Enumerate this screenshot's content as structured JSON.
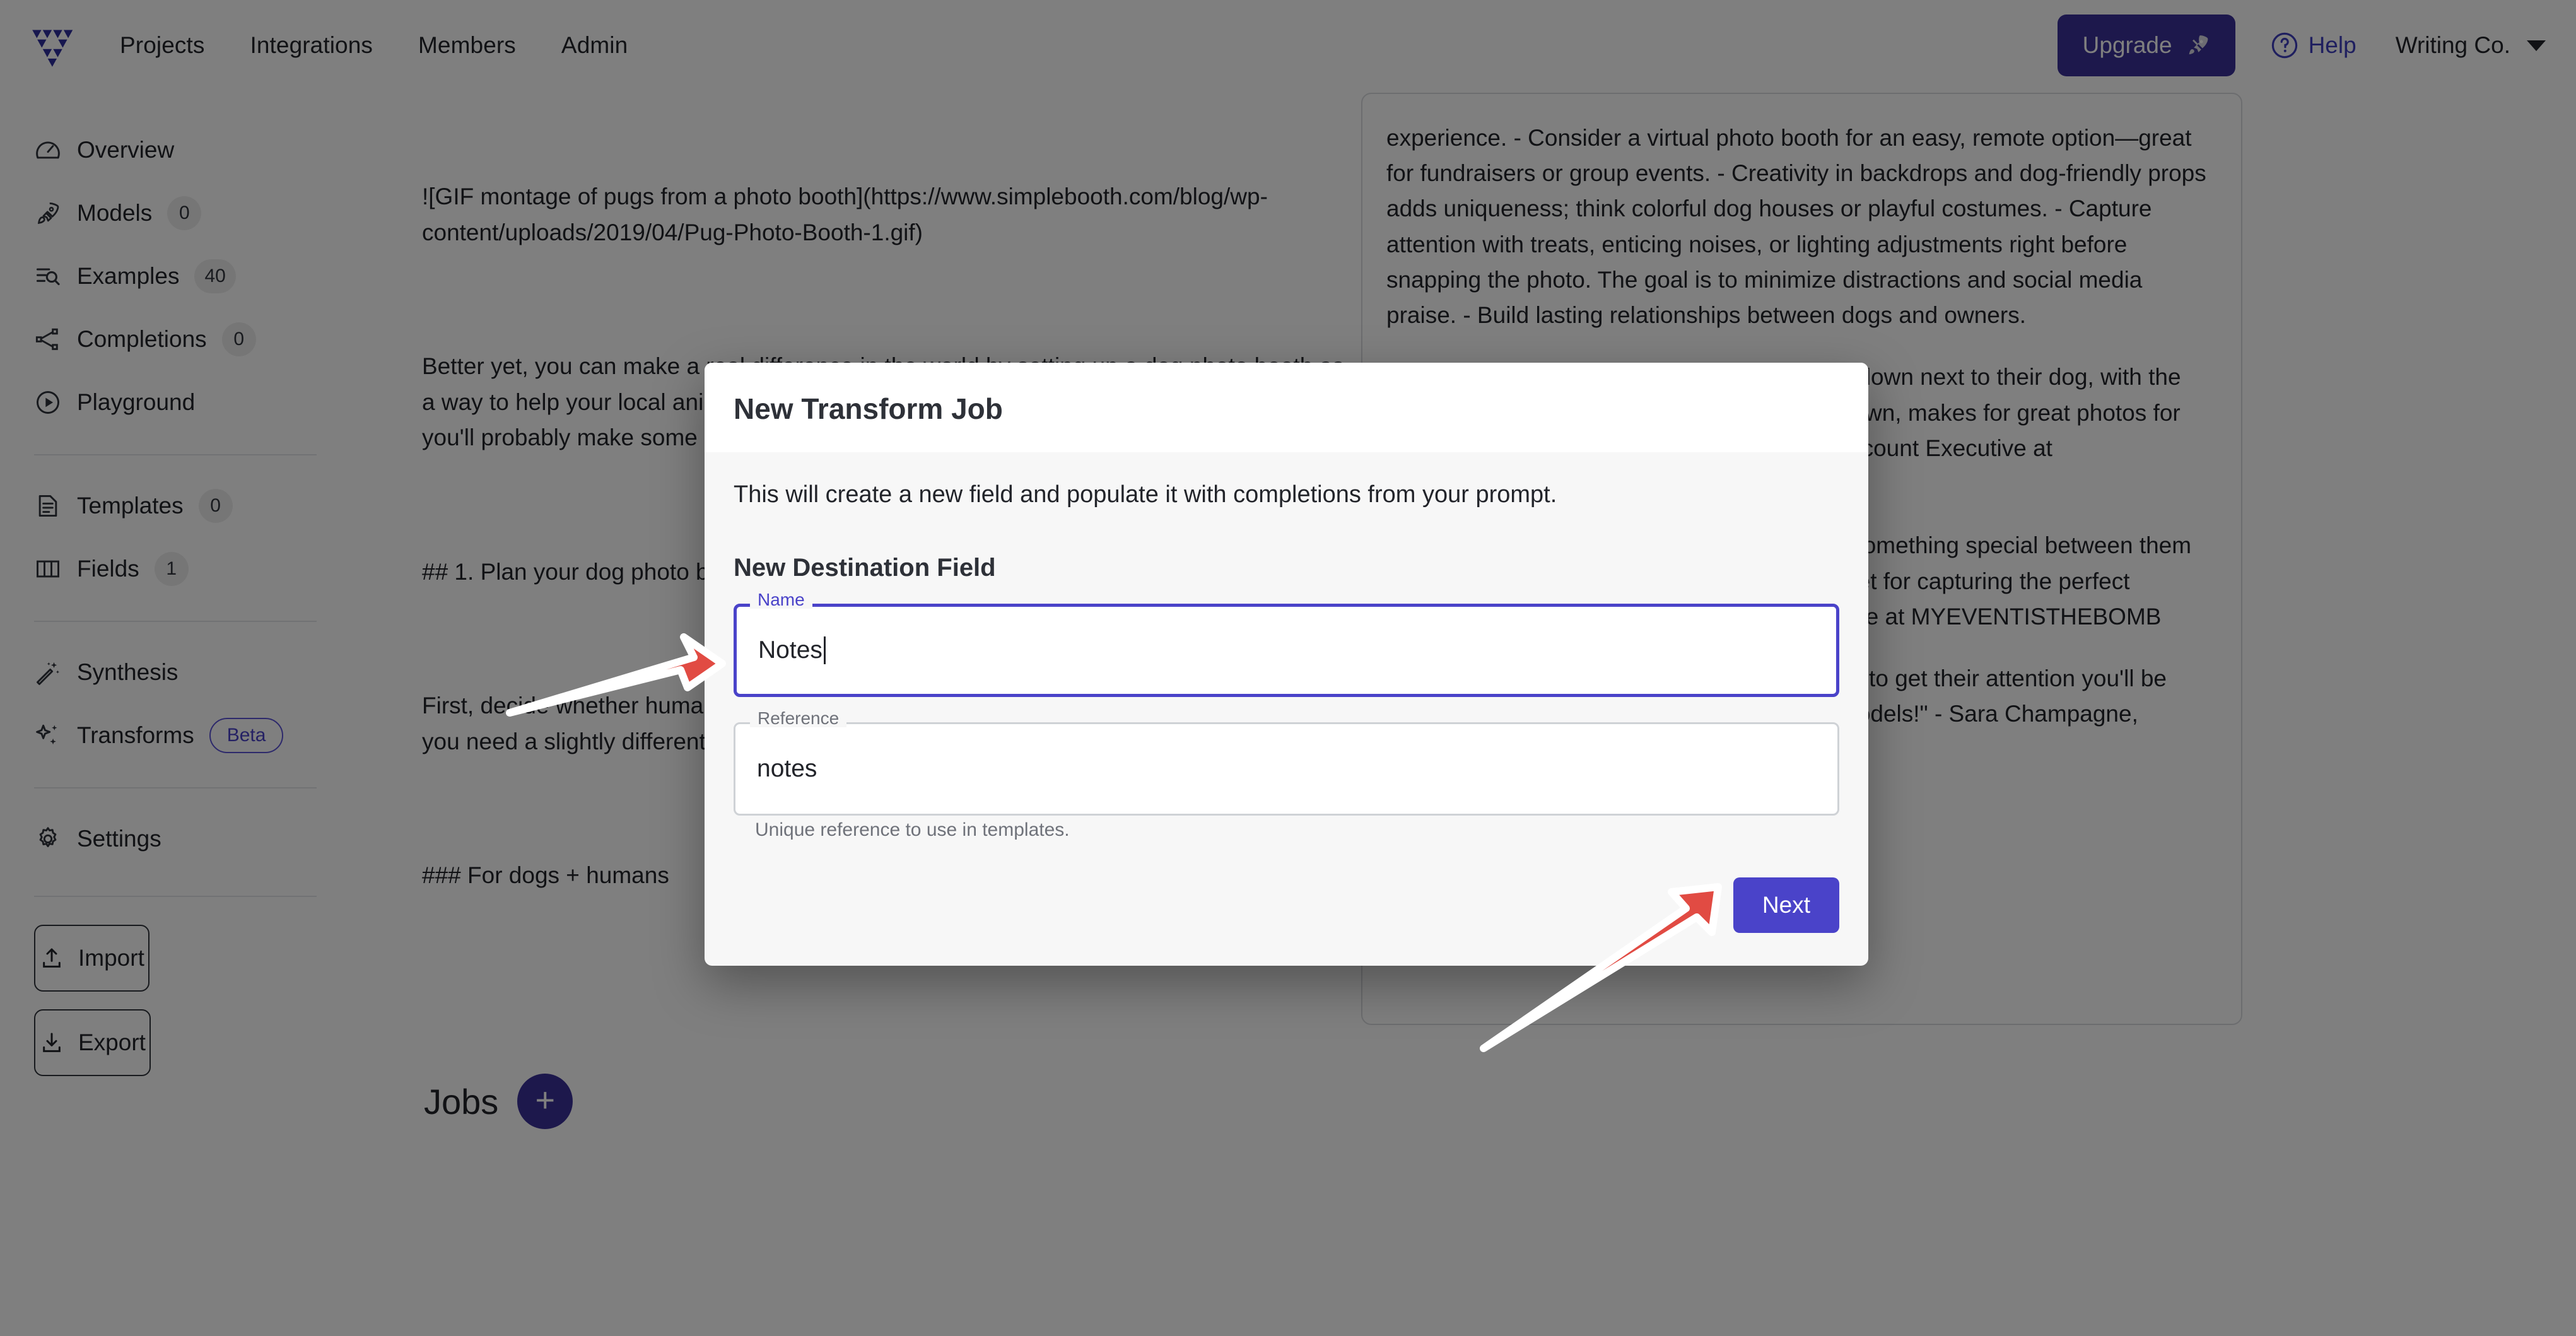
{
  "topnav": {
    "logo_name": "vellum-logo",
    "links": [
      "Projects",
      "Integrations",
      "Members",
      "Admin"
    ],
    "upgrade_label": "Upgrade",
    "help_label": "Help",
    "org_label": "Writing Co.",
    "accent_color": "#3b3099"
  },
  "sidebar": {
    "group1": [
      {
        "label": "Overview",
        "icon": "gauge-icon",
        "badge": null
      },
      {
        "label": "Models",
        "icon": "rocket-icon",
        "badge": "0"
      },
      {
        "label": "Examples",
        "icon": "list-search-icon",
        "badge": "40"
      },
      {
        "label": "Completions",
        "icon": "nodes-icon",
        "badge": "0"
      },
      {
        "label": "Playground",
        "icon": "play-circle-icon",
        "badge": null
      }
    ],
    "group2": [
      {
        "label": "Templates",
        "icon": "document-icon",
        "badge": "0"
      },
      {
        "label": "Fields",
        "icon": "columns-icon",
        "badge": "1"
      }
    ],
    "group3": [
      {
        "label": "Synthesis",
        "icon": "magic-wand-icon",
        "badge": null
      },
      {
        "label": "Transforms",
        "icon": "sparkles-icon",
        "badge": "Beta",
        "badge_style": "beta"
      }
    ],
    "group4": [
      {
        "label": "Settings",
        "icon": "gear-icon",
        "badge": null
      }
    ],
    "import_label": "Import",
    "export_label": "Export"
  },
  "main": {
    "document_paragraphs": [
      "![GIF montage of pugs from a photo booth](https://www.simplebooth.com/blog/wp-content/uploads/2019/04/Pug-Photo-Booth-1.gif)",
      "Better yet, you can make a real difference in the world by setting up a dog photo booth as a way to help your local animal shelter. It's a great way to help with animal adoption, and you'll probably make some great new canine friends along the way.",
      "## 1. Plan your dog photo booth",
      "First, decide whether humans and their furry friends will be getting personal photos or if you need a slightly different game plan.",
      "### For dogs + humans"
    ],
    "right_panel_paragraphs": [
      "experience.\n- Consider a virtual photo booth for an easy, remote option—great for fundraisers or group events.\n- Creativity in backdrops and dog-friendly props adds uniqueness; think colorful dog houses or playful costumes.\n- Capture attention with treats, enticing noises, or lighting adjustments right before snapping the photo. The goal is to minimize distractions and social media praise.\n- Build lasting relationships between dogs and owners.",
      "\"Setting up a low bench where people can sit down next to their dog, with the camera slightly above eye level and angled down, makes for great photos for people and their pets.\" - Sara Champagne, Account Executive at MYEVENTISTHEBOMB",
      "\"Taking photos where dogs and people have something special between them makes each photo more unique and is an asset for capturing the perfect picture.\" - Sara Champagne, Account Executive at MYEVENTISTHEBOMB",
      "Dogs are a bit trickier, but once you know how to get their attention you'll be able to pose them to. They're actually good models!\" - Sara Champagne, Account Executive at MYEVENTISTHEBOMB"
    ],
    "jobs_title": "Jobs",
    "add_job_icon": "plus-icon"
  },
  "modal": {
    "title": "New Transform Job",
    "description": "This will create a new field and populate it with completions from your prompt.",
    "section_title": "New Destination Field",
    "name_field": {
      "legend": "Name",
      "value": "Notes",
      "focused": true
    },
    "reference_field": {
      "legend": "Reference",
      "value": "notes",
      "focused": false
    },
    "reference_help": "Unique reference to use in templates.",
    "next_label": "Next",
    "accent_color": "#4a43c9"
  },
  "annotations": {
    "arrow_color": "#e14b43",
    "arrow1_target": "name-input",
    "arrow2_target": "next-button"
  }
}
